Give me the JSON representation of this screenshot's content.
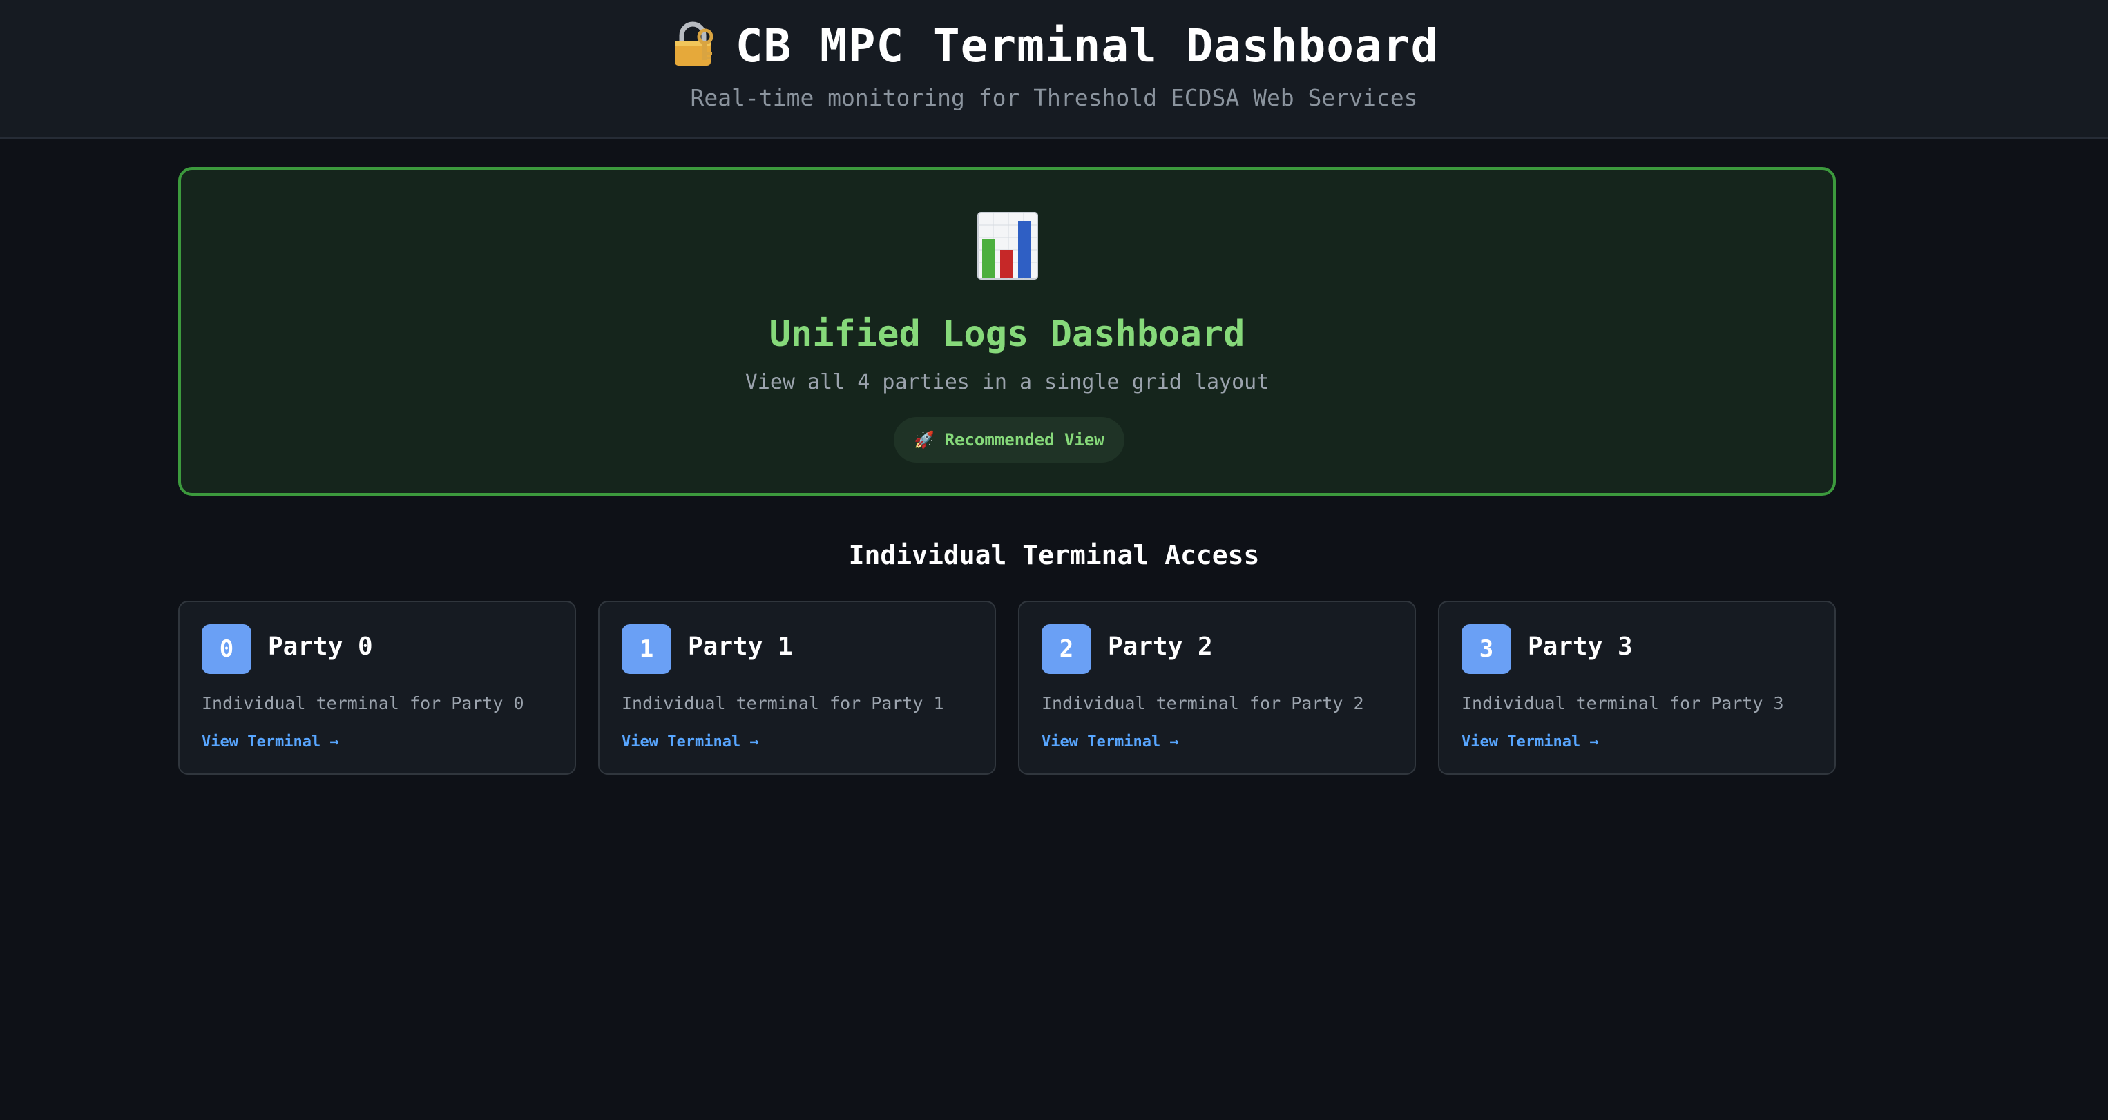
{
  "header": {
    "title_icon": "lock-with-key-icon",
    "title": "CB MPC Terminal Dashboard",
    "subtitle": "Real-time monitoring for Threshold ECDSA Web Services"
  },
  "hero": {
    "icon": "bar-chart-icon",
    "title": "Unified Logs Dashboard",
    "description": "View all 4 parties in a single grid layout",
    "badge": "🚀 Recommended View"
  },
  "section": {
    "title": "Individual Terminal Access"
  },
  "parties": [
    {
      "number": "0",
      "title": "Party 0",
      "description": "Individual terminal for Party 0",
      "link": "View Terminal →"
    },
    {
      "number": "1",
      "title": "Party 1",
      "description": "Individual terminal for Party 1",
      "link": "View Terminal →"
    },
    {
      "number": "2",
      "title": "Party 2",
      "description": "Individual terminal for Party 2",
      "link": "View Terminal →"
    },
    {
      "number": "3",
      "title": "Party 3",
      "description": "Individual terminal for Party 3",
      "link": "View Terminal →"
    }
  ],
  "colors": {
    "background": "#0e1117",
    "header": "#161b22",
    "hero_border": "#3c9a3d",
    "hero_text": "#86d97a",
    "party_badge": "#6aa0f5",
    "link": "#58a6ff"
  }
}
